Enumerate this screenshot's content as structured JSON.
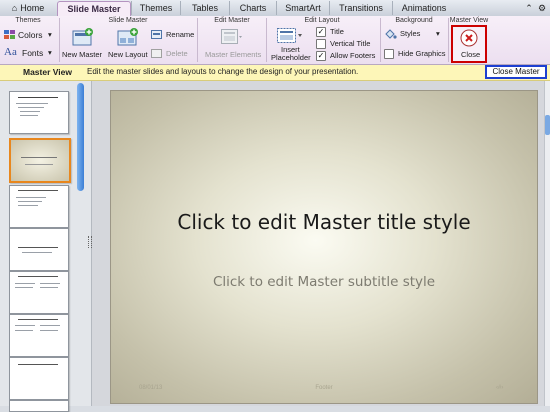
{
  "tabs": [
    {
      "label": "Home",
      "active": false
    },
    {
      "label": "Slide Master",
      "active": true
    },
    {
      "label": "Themes",
      "active": false
    },
    {
      "label": "Tables",
      "active": false
    },
    {
      "label": "Charts",
      "active": false
    },
    {
      "label": "SmartArt",
      "active": false
    },
    {
      "label": "Transitions",
      "active": false
    },
    {
      "label": "Animations",
      "active": false
    }
  ],
  "ribbon": {
    "themes": {
      "title": "Themes",
      "colors": "Colors",
      "fonts": "Fonts"
    },
    "slide_master": {
      "title": "Slide Master",
      "new_master": "New Master",
      "new_layout": "New Layout",
      "rename": "Rename",
      "delete": "Delete"
    },
    "edit_master": {
      "title": "Edit Master",
      "master_elements": "Master Elements"
    },
    "edit_layout": {
      "title": "Edit Layout",
      "insert_placeholder_1": "Insert",
      "insert_placeholder_2": "Placeholder",
      "title_chk": "Title",
      "vertical_title_chk": "Vertical Title",
      "allow_footers_chk": "Allow Footers",
      "title_checked": true,
      "vertical_title_checked": false,
      "allow_footers_checked": true
    },
    "background": {
      "title": "Background",
      "styles": "Styles",
      "hide_graphics": "Hide Graphics",
      "hide_graphics_checked": false
    },
    "master_view": {
      "title": "Master View",
      "close": "Close"
    }
  },
  "infobar": {
    "label": "Master View",
    "message": "Edit the master slides and layouts to change the design of your presentation.",
    "close_master": "Close Master"
  },
  "slide": {
    "title": "Click to edit Master title style",
    "subtitle": "Click to edit Master subtitle style",
    "date": "08/01/13",
    "footer": "Footer",
    "page": "‹#›"
  },
  "colors": {
    "highlight_red": "#cc0000",
    "highlight_blue": "#1d3fd0",
    "selected_thumb": "#e8871e",
    "infobar": "#fdf6b8"
  }
}
